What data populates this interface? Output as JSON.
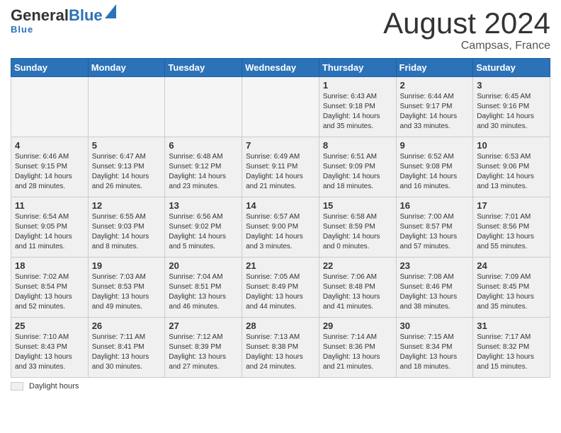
{
  "header": {
    "logo_general": "General",
    "logo_blue": "Blue",
    "title": "August 2024",
    "location": "Campsas, France"
  },
  "footer": {
    "shaded_label": "Daylight hours"
  },
  "calendar": {
    "days_of_week": [
      "Sunday",
      "Monday",
      "Tuesday",
      "Wednesday",
      "Thursday",
      "Friday",
      "Saturday"
    ],
    "weeks": [
      [
        {
          "day": "",
          "empty": true
        },
        {
          "day": "",
          "empty": true
        },
        {
          "day": "",
          "empty": true
        },
        {
          "day": "",
          "empty": true
        },
        {
          "day": "1",
          "sunrise": "6:43 AM",
          "sunset": "9:18 PM",
          "daylight": "14 hours and 35 minutes."
        },
        {
          "day": "2",
          "sunrise": "6:44 AM",
          "sunset": "9:17 PM",
          "daylight": "14 hours and 33 minutes."
        },
        {
          "day": "3",
          "sunrise": "6:45 AM",
          "sunset": "9:16 PM",
          "daylight": "14 hours and 30 minutes."
        }
      ],
      [
        {
          "day": "4",
          "sunrise": "6:46 AM",
          "sunset": "9:15 PM",
          "daylight": "14 hours and 28 minutes."
        },
        {
          "day": "5",
          "sunrise": "6:47 AM",
          "sunset": "9:13 PM",
          "daylight": "14 hours and 26 minutes."
        },
        {
          "day": "6",
          "sunrise": "6:48 AM",
          "sunset": "9:12 PM",
          "daylight": "14 hours and 23 minutes."
        },
        {
          "day": "7",
          "sunrise": "6:49 AM",
          "sunset": "9:11 PM",
          "daylight": "14 hours and 21 minutes."
        },
        {
          "day": "8",
          "sunrise": "6:51 AM",
          "sunset": "9:09 PM",
          "daylight": "14 hours and 18 minutes."
        },
        {
          "day": "9",
          "sunrise": "6:52 AM",
          "sunset": "9:08 PM",
          "daylight": "14 hours and 16 minutes."
        },
        {
          "day": "10",
          "sunrise": "6:53 AM",
          "sunset": "9:06 PM",
          "daylight": "14 hours and 13 minutes."
        }
      ],
      [
        {
          "day": "11",
          "sunrise": "6:54 AM",
          "sunset": "9:05 PM",
          "daylight": "14 hours and 11 minutes."
        },
        {
          "day": "12",
          "sunrise": "6:55 AM",
          "sunset": "9:03 PM",
          "daylight": "14 hours and 8 minutes."
        },
        {
          "day": "13",
          "sunrise": "6:56 AM",
          "sunset": "9:02 PM",
          "daylight": "14 hours and 5 minutes."
        },
        {
          "day": "14",
          "sunrise": "6:57 AM",
          "sunset": "9:00 PM",
          "daylight": "14 hours and 3 minutes."
        },
        {
          "day": "15",
          "sunrise": "6:58 AM",
          "sunset": "8:59 PM",
          "daylight": "14 hours and 0 minutes."
        },
        {
          "day": "16",
          "sunrise": "7:00 AM",
          "sunset": "8:57 PM",
          "daylight": "13 hours and 57 minutes."
        },
        {
          "day": "17",
          "sunrise": "7:01 AM",
          "sunset": "8:56 PM",
          "daylight": "13 hours and 55 minutes."
        }
      ],
      [
        {
          "day": "18",
          "sunrise": "7:02 AM",
          "sunset": "8:54 PM",
          "daylight": "13 hours and 52 minutes."
        },
        {
          "day": "19",
          "sunrise": "7:03 AM",
          "sunset": "8:53 PM",
          "daylight": "13 hours and 49 minutes."
        },
        {
          "day": "20",
          "sunrise": "7:04 AM",
          "sunset": "8:51 PM",
          "daylight": "13 hours and 46 minutes."
        },
        {
          "day": "21",
          "sunrise": "7:05 AM",
          "sunset": "8:49 PM",
          "daylight": "13 hours and 44 minutes."
        },
        {
          "day": "22",
          "sunrise": "7:06 AM",
          "sunset": "8:48 PM",
          "daylight": "13 hours and 41 minutes."
        },
        {
          "day": "23",
          "sunrise": "7:08 AM",
          "sunset": "8:46 PM",
          "daylight": "13 hours and 38 minutes."
        },
        {
          "day": "24",
          "sunrise": "7:09 AM",
          "sunset": "8:45 PM",
          "daylight": "13 hours and 35 minutes."
        }
      ],
      [
        {
          "day": "25",
          "sunrise": "7:10 AM",
          "sunset": "8:43 PM",
          "daylight": "13 hours and 33 minutes."
        },
        {
          "day": "26",
          "sunrise": "7:11 AM",
          "sunset": "8:41 PM",
          "daylight": "13 hours and 30 minutes."
        },
        {
          "day": "27",
          "sunrise": "7:12 AM",
          "sunset": "8:39 PM",
          "daylight": "13 hours and 27 minutes."
        },
        {
          "day": "28",
          "sunrise": "7:13 AM",
          "sunset": "8:38 PM",
          "daylight": "13 hours and 24 minutes."
        },
        {
          "day": "29",
          "sunrise": "7:14 AM",
          "sunset": "8:36 PM",
          "daylight": "13 hours and 21 minutes."
        },
        {
          "day": "30",
          "sunrise": "7:15 AM",
          "sunset": "8:34 PM",
          "daylight": "13 hours and 18 minutes."
        },
        {
          "day": "31",
          "sunrise": "7:17 AM",
          "sunset": "8:32 PM",
          "daylight": "13 hours and 15 minutes."
        }
      ]
    ]
  }
}
